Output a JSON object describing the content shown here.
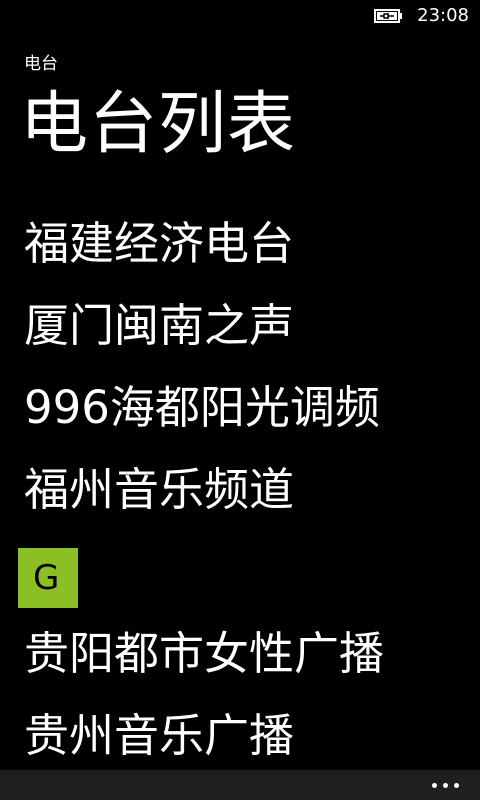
{
  "status_bar": {
    "battery_icon": "battery-charging-icon",
    "time": "23:08"
  },
  "header": {
    "app_name": "电台",
    "title": "电台列表"
  },
  "stations": {
    "items": [
      {
        "type": "station",
        "label": "福建经济电台"
      },
      {
        "type": "station",
        "label": "厦门闽南之声"
      },
      {
        "type": "station",
        "label": "996海都阳光调频"
      },
      {
        "type": "station",
        "label": "福州音乐频道"
      },
      {
        "type": "group",
        "label": "G"
      },
      {
        "type": "station",
        "label": "贵阳都市女性广播"
      },
      {
        "type": "station",
        "label": "贵州音乐广播"
      }
    ]
  },
  "app_bar": {
    "more_icon": "ellipsis-icon"
  },
  "colors": {
    "background": "#000000",
    "text": "#ffffff",
    "accent": "#8cbf26",
    "app_bar": "#1f1f1f"
  }
}
